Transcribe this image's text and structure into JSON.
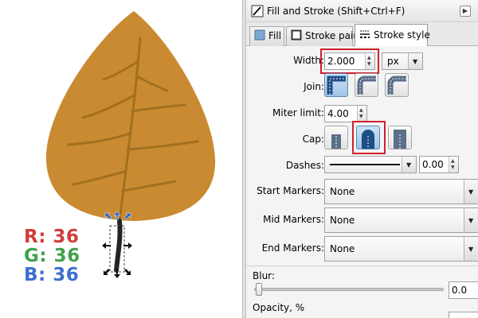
{
  "rgb": {
    "r": "R: 36",
    "g": "G: 36",
    "b": "B: 36"
  },
  "colors": {
    "leaf_fill": "#c98a31",
    "leaf_vein": "#a2701f",
    "stem": "#242424",
    "handle_blue": "#2a63d8",
    "r_text": "#d23c3c",
    "g_text": "#3ea24a",
    "b_text": "#3b6fcf",
    "highlight_box": "#d0202a"
  },
  "dialog": {
    "title": "Fill and Stroke (Shift+Ctrl+F)",
    "tabs": [
      {
        "label": "Fill",
        "icon": "fill-icon"
      },
      {
        "label": "Stroke paint",
        "icon": "stroke-paint-icon"
      },
      {
        "label": "Stroke style",
        "icon": "stroke-style-icon"
      }
    ],
    "width": {
      "label": "Width:",
      "value": "2.000",
      "unit": "px"
    },
    "join": {
      "label": "Join:"
    },
    "miter": {
      "label": "Miter limit:",
      "value": "4.00"
    },
    "cap": {
      "label": "Cap:"
    },
    "dashes": {
      "label": "Dashes:",
      "offset": "0.00"
    },
    "start_markers": {
      "label": "Start Markers:",
      "value": "None"
    },
    "mid_markers": {
      "label": "Mid Markers:",
      "value": "None"
    },
    "end_markers": {
      "label": "End Markers:",
      "value": "None"
    },
    "blur": {
      "label": "Blur:",
      "value": "0.0"
    },
    "opacity": {
      "label": "Opacity, %"
    }
  }
}
